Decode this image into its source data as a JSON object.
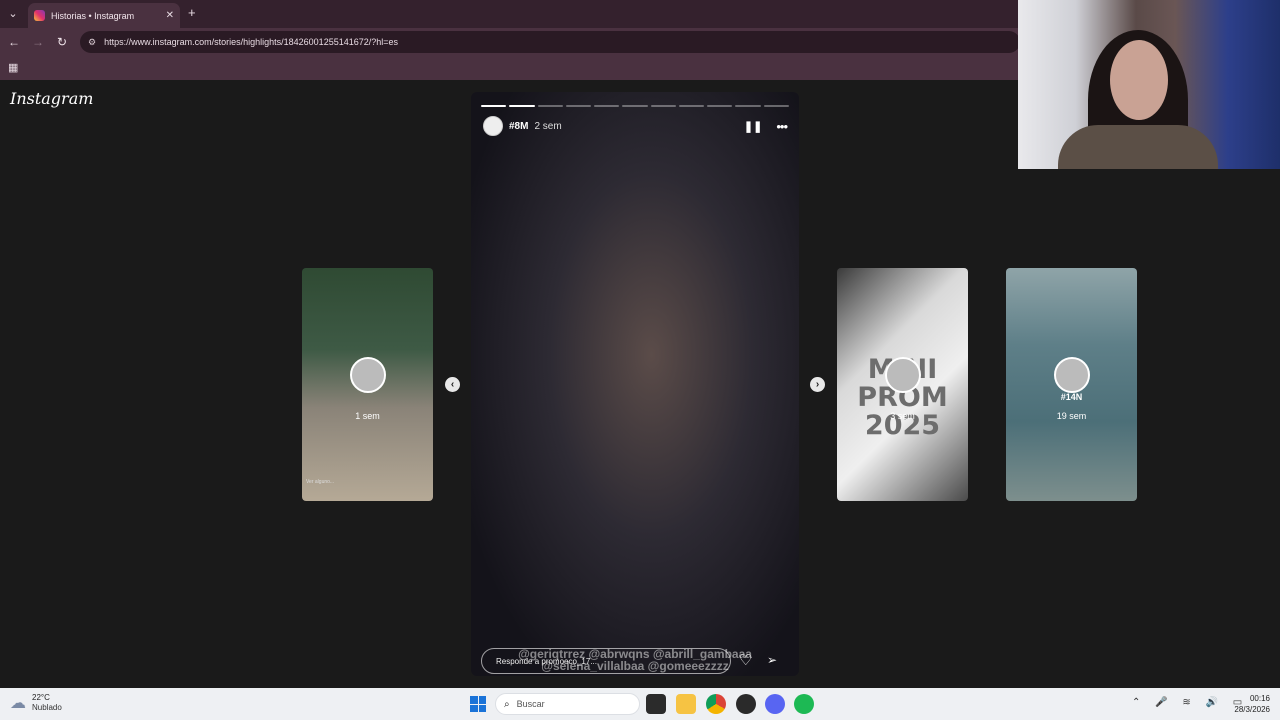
{
  "browser": {
    "tab_title": "Historias • Instagram",
    "tab_close": "✕",
    "new_tab": "+",
    "url": "https://www.instagram.com/stories/highlights/18426001255141672/?hl=es",
    "back": "←",
    "forward": "→",
    "reload": "↻"
  },
  "page": {
    "logo": "Instagram",
    "main_story": {
      "name": "#8M",
      "time": "2 sem",
      "tags": "@geriqtrrez @abrwqns @abrill_gambaaa @selena_villalbaa @gomeeezzzz",
      "reply_placeholder": "Responde a promoeco_17...",
      "progress_total": 11,
      "progress_done": 2
    },
    "side_stories": [
      {
        "name": "",
        "time": "1 sem",
        "caption": "Ver alguno..."
      },
      {
        "name": "",
        "time": "3 sem",
        "graphic_text": "MINI PROM 2025"
      },
      {
        "name": "#14N",
        "time": "19 sem"
      }
    ],
    "arrows": {
      "prev": "‹",
      "next": "›"
    }
  },
  "taskbar": {
    "temp": "22°C",
    "weather": "Nublado",
    "search_placeholder": "Buscar",
    "time": "00:16",
    "date": "28/3/2026"
  }
}
